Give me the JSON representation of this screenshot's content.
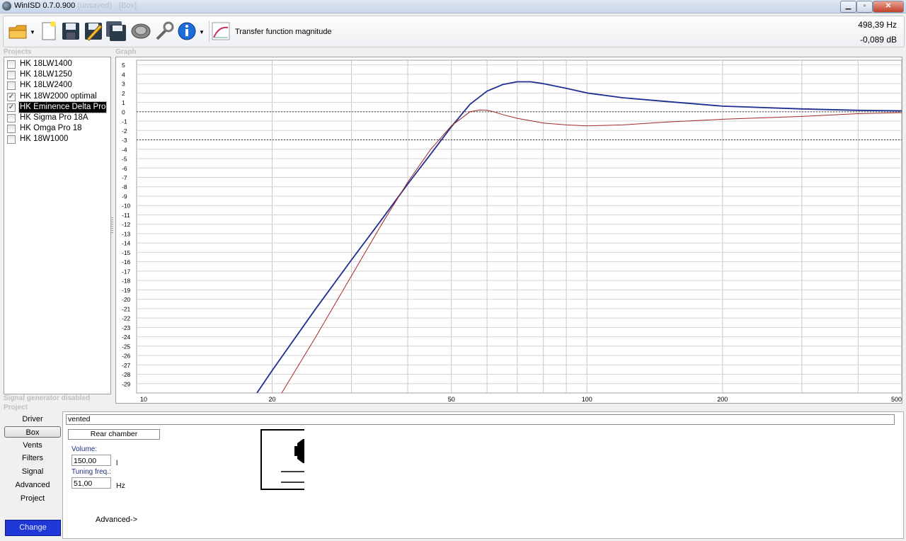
{
  "window": {
    "title": "WinISD 0.7.0.900",
    "title_suffix": "(unsaved) - [Box]"
  },
  "toolbar": {
    "icons": [
      "open-folder-icon",
      "new-document-icon",
      "save-icon",
      "save-as-icon",
      "save-all-icon",
      "driver-icon",
      "tools-icon",
      "info-icon",
      "transfer-function-icon"
    ],
    "graph_type_label": "Transfer function magnitude",
    "readout_frequency": "498,39 Hz",
    "readout_level": "-0,089 dB"
  },
  "projects": {
    "header": "Projects",
    "items": [
      {
        "label": "HK 18LW1400",
        "checked": false,
        "selected": false
      },
      {
        "label": "HK 18LW1250",
        "checked": false,
        "selected": false
      },
      {
        "label": "HK 18LW2400",
        "checked": false,
        "selected": false
      },
      {
        "label": "HK 18W2000 optimal",
        "checked": true,
        "selected": false
      },
      {
        "label": "HK Eminence Delta Pro",
        "checked": true,
        "selected": true
      },
      {
        "label": "HK Sigma Pro 18A",
        "checked": false,
        "selected": false
      },
      {
        "label": "HK Omga Pro 18",
        "checked": false,
        "selected": false
      },
      {
        "label": "HK 18W1000",
        "checked": false,
        "selected": false
      }
    ]
  },
  "status": {
    "signal_generator": "Signal generator disabled"
  },
  "graph_header": "Graph",
  "project_header": "Project",
  "nav": {
    "items": [
      "Driver",
      "Box",
      "Vents",
      "Filters",
      "Signal",
      "Advanced",
      "Project"
    ],
    "active": "Box",
    "change_label": "Change"
  },
  "box": {
    "type": "vented",
    "rear_chamber_label": "Rear chamber",
    "volume_label": "Volume:",
    "volume_value": "150,00",
    "volume_unit": "l",
    "tuning_label": "Tuning freq.:",
    "tuning_value": "51,00",
    "tuning_unit": "Hz",
    "advanced_label": "Advanced->"
  },
  "chart_data": {
    "type": "line",
    "xscale": "log",
    "xlim": [
      10,
      500
    ],
    "ylim": [
      -30,
      5
    ],
    "x_ticks": [
      10,
      20,
      50,
      100,
      200,
      500
    ],
    "y_ticks": [
      5,
      4,
      3,
      2,
      1,
      0,
      -1,
      -2,
      -3,
      -4,
      -5,
      -6,
      -7,
      -8,
      -9,
      -10,
      -11,
      -12,
      -13,
      -14,
      -15,
      -16,
      -17,
      -18,
      -19,
      -20,
      -21,
      -22,
      -23,
      -24,
      -25,
      -26,
      -27,
      -28,
      -29
    ],
    "reference_lines": [
      0,
      -3
    ],
    "grid": true,
    "series": [
      {
        "color": "#1f2f8f",
        "x": [
          18.5,
          20,
          25,
          30,
          35,
          40,
          45,
          50,
          55,
          60,
          65,
          70,
          75,
          80,
          90,
          100,
          120,
          150,
          200,
          300,
          400,
          500
        ],
        "y": [
          -30,
          -27.6,
          -21,
          -15.8,
          -11.5,
          -7.7,
          -4.5,
          -1.6,
          0.8,
          2.2,
          2.9,
          3.2,
          3.2,
          3,
          2.5,
          2,
          1.5,
          1.1,
          0.6,
          0.3,
          0.15,
          0.1
        ]
      },
      {
        "color": "#a02828",
        "x": [
          21,
          25,
          30,
          35,
          40,
          45,
          50,
          55,
          58,
          60,
          62,
          65,
          70,
          80,
          90,
          100,
          120,
          150,
          200,
          300,
          400,
          500
        ],
        "y": [
          -30,
          -24,
          -17.5,
          -12,
          -7.5,
          -4,
          -1.5,
          0,
          0.2,
          0.15,
          0,
          -0.3,
          -0.7,
          -1.2,
          -1.4,
          -1.5,
          -1.4,
          -1.1,
          -0.8,
          -0.5,
          -0.2,
          -0.1
        ]
      }
    ]
  }
}
